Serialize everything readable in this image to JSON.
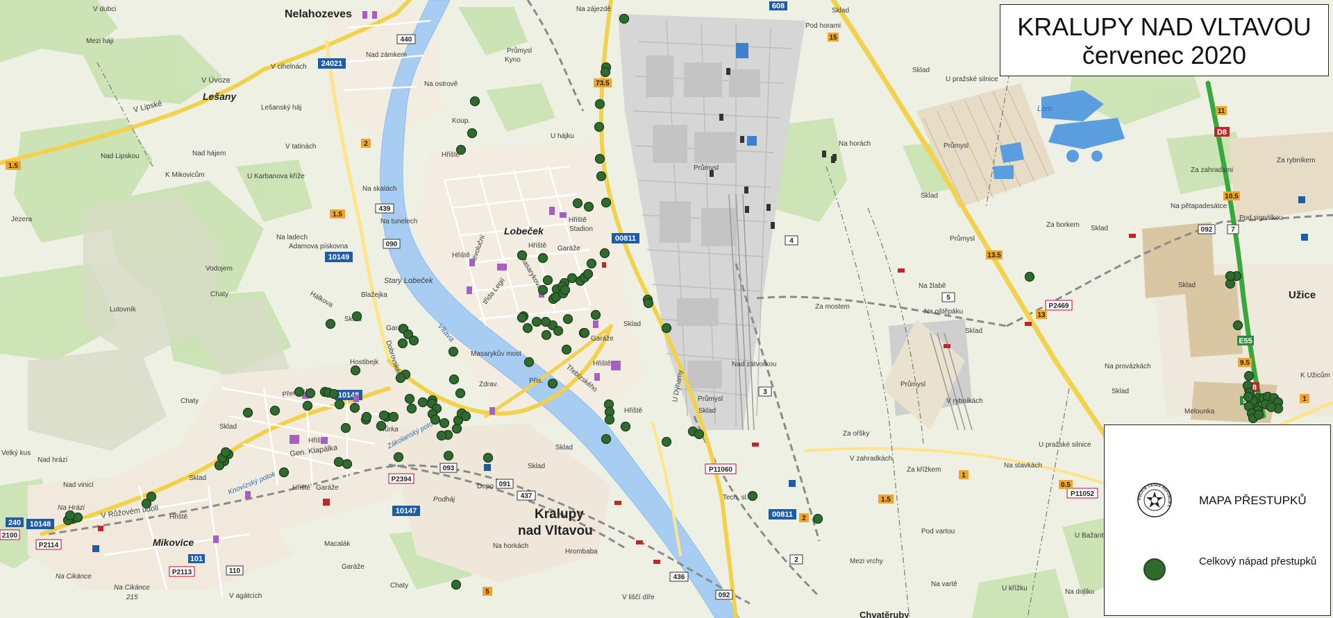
{
  "title": {
    "line1": "KRALUPY NAD VLTAVOU",
    "line2": "červenec 2020"
  },
  "legend": {
    "police_label": "MAPA PŘESTUPKŮ",
    "dot_label": "Celkový nápad přestupků",
    "logo_ring_text": "POLICIE ČESKÉ REPUBLIKY",
    "dot_color": "#2f6a2f"
  },
  "map": {
    "labels": {
      "nelahozeves": "Nelahozeves",
      "kralupy1": "Kralupy",
      "kralupy2": "nad Vltavou",
      "lobecek": "Lobeček",
      "lesany": "Lešany",
      "uzice": "Užice",
      "mikovice": "Mikovice",
      "vltava": "Vltava",
      "stary_lobecek": "Starý Lobeček",
      "prumysl": "Průmysl",
      "za_mostem": "Za mostem",
      "na_horach": "Na horách",
      "lom": "Lom",
      "za_borkem": "Za borkem",
      "na_zlabe": "Na žlabě",
      "na_ostepaku": "Na oštěpáku",
      "v_rybnikach": "V rybníkách",
      "na_provazkach": "Na provázkách",
      "melounka": "Melounka",
      "za_orsky": "Za ořšky",
      "v_zahradkach": "V zahradkách",
      "za_krizkem": "Za křížkem",
      "na_stavkach": "Na stavkách",
      "pod_vartou": "Pod vartou",
      "nad_zatvorkou": "Nad zátvorkou",
      "masarykuv_most": "Masarykův most",
      "prerovska": "Přerovská",
      "v_uvoze": "V Úvoze",
      "v_lipske": "V Lipské",
      "nad_lipskou": "Nad Lipskou",
      "nad_hajem": "Nad hájem",
      "k_mikovicum": "K Mikovicům",
      "v_tatinach": "V tatinách",
      "v_cihelnach": "V cihelnách",
      "mezi_haji": "Mezi háji",
      "v_dubci": "V dubci",
      "nad_zamkem": "Nad zámkem",
      "na_ostrove": "Na ostrově",
      "u_hajku": "U hájku",
      "na_skalach": "Na skalách",
      "na_tunelech": "Na tunelech",
      "na_ladech": "Na ladech",
      "adamova_piskovna": "Adamova pískovna",
      "vodojem": "Vodojem",
      "lutovnik": "Lutovník",
      "chaty": "Chaty",
      "hostibejk": "Hostibejk",
      "blazejka": "Blažejka",
      "halkova": "Hálkova",
      "dobrovskeho": "Dobrovského",
      "garaze": "Garáže",
      "skolni": "Sklad",
      "hriste": "Hřiště",
      "stadion": "Stadion",
      "trebizskeho": "Třebízského",
      "masarykova": "Masarykova",
      "revolucni": "Revoluční",
      "trida_legii": "třída Legií",
      "gen_klapalka": "Gen. Klapálka",
      "v_ruzovem_udoli": "V Růžovém údolí",
      "na_hrazi": "Na Hrázi",
      "na_cikance": "Na Cikánce",
      "na_horkach": "Na horkách",
      "hrombaba": "Hrombaba",
      "podhaji": "Podháj",
      "depo": "Depo",
      "zakolansky_potok": "Zákolanský potok",
      "knovizsky_potok": "Knovízský potok",
      "na_zajezde": "Na zájezdě",
      "pod_horami": "Pod horami",
      "u_prazske_silnice": "U pražské silnice",
      "za_rybnikem": "Za rybníkem",
      "za_zahradami": "Za zahradami",
      "na_petapadesatce": "Na pětapadesátce",
      "pod_signalkou": "Pod signálkou",
      "velky_kus": "Velký kus",
      "nad_hrazi": "Nad hrází",
      "nad_vinici": "Nad vinicí",
      "jezera": "Jezera",
      "kyno": "Kyno",
      "koup": "Koup.",
      "zdrav": "Zdrav.",
      "pris": "Přís.",
      "u_dyhamy": "U Dýhamy",
      "mezi_vrchy": "Mezi vrchy",
      "u_krizku": "U křížku",
      "na_varte": "Na vartě",
      "na_dolku": "Na dolíku",
      "u_bazantnice": "U Bažantnice",
      "k_uzicum": "K Užicům",
      "v_lisci_dire": "V liščí díře",
      "tech_sl": "Tech. sl.",
      "v_agatcich": "V agátcích",
      "macalak": "Macalák",
      "chvatěruby": "Chvatěruby",
      "lesansky_haj": "Lešanský háj",
      "u_karbanova_krize": "U Karbanova kříže",
      "na_cikance_num": "215",
      "mezi": "Sklad",
      "hurka": "Hůrka",
      "rulovci": "Růžové údolí",
      "rybnik": "Sklad",
      "u_prazske2": "U pražské silnice"
    },
    "shields": {
      "r440": "440",
      "r24021": "24021",
      "r439": "439",
      "r10149": "10149",
      "r090": "090",
      "r10148": "10148",
      "r10147": "10147",
      "r093": "093",
      "r091": "091",
      "r437": "437",
      "r436": "436",
      "r092": "092",
      "r00811": "00811",
      "r00811b": "00811",
      "p2394": "P2394",
      "p2114": "P2114",
      "p2113": "P2113",
      "p11060": "P11060",
      "p2469": "P2469",
      "p11052": "P11052",
      "r101": "101",
      "r110": "110",
      "r240": "240",
      "r2100": "2100",
      "r608": "608",
      "r4": "4",
      "r5": "5",
      "r3": "3",
      "r2": "2",
      "r7": "7",
      "d8a": "D8",
      "d8b": "D8",
      "e55": "E55",
      "km73": "73.5",
      "km15": "15",
      "km13": "13",
      "km135": "13.5",
      "km105": "10.5",
      "km95": "9.5",
      "km11": "11",
      "km15b": "1.5",
      "km15c": "1.5",
      "km15d": "1.5",
      "km2": "2",
      "km5": "5",
      "km1": "1",
      "km05": "0.5",
      "km9": "9",
      "km2b": "2",
      "km1b": "1"
    }
  },
  "incidents": [
    [
      899,
      27
    ],
    [
      873,
      97
    ],
    [
      872,
      104
    ],
    [
      684,
      146
    ],
    [
      680,
      192
    ],
    [
      664,
      216
    ],
    [
      864,
      150
    ],
    [
      863,
      183
    ],
    [
      864,
      229
    ],
    [
      866,
      254
    ],
    [
      873,
      292
    ],
    [
      832,
      293
    ],
    [
      848,
      298
    ],
    [
      871,
      365
    ],
    [
      852,
      380
    ],
    [
      824,
      401
    ],
    [
      836,
      405
    ],
    [
      842,
      400
    ],
    [
      847,
      395
    ],
    [
      813,
      408
    ],
    [
      802,
      417
    ],
    [
      810,
      413
    ],
    [
      752,
      368
    ],
    [
      782,
      372
    ],
    [
      789,
      404
    ],
    [
      782,
      418
    ],
    [
      797,
      431
    ],
    [
      801,
      428
    ],
    [
      811,
      423
    ],
    [
      814,
      418
    ],
    [
      754,
      456
    ],
    [
      773,
      464
    ],
    [
      796,
      469
    ],
    [
      786,
      464
    ],
    [
      804,
      477
    ],
    [
      787,
      483
    ],
    [
      818,
      460
    ],
    [
      841,
      480
    ],
    [
      816,
      504
    ],
    [
      752,
      458
    ],
    [
      760,
      473
    ],
    [
      762,
      522
    ],
    [
      796,
      553
    ],
    [
      842,
      480
    ],
    [
      858,
      454
    ],
    [
      933,
      432
    ],
    [
      934,
      437
    ],
    [
      960,
      473
    ],
    [
      877,
      583
    ],
    [
      878,
      594
    ],
    [
      878,
      605
    ],
    [
      873,
      633
    ],
    [
      901,
      615
    ],
    [
      998,
      622
    ],
    [
      1007,
      626
    ],
    [
      960,
      637
    ],
    [
      1084,
      715
    ],
    [
      1178,
      748
    ],
    [
      653,
      507
    ],
    [
      654,
      547
    ],
    [
      663,
      567
    ],
    [
      581,
      474
    ],
    [
      588,
      482
    ],
    [
      596,
      491
    ],
    [
      580,
      495
    ],
    [
      584,
      540
    ],
    [
      577,
      545
    ],
    [
      590,
      575
    ],
    [
      593,
      589
    ],
    [
      609,
      580
    ],
    [
      557,
      601
    ],
    [
      574,
      659
    ],
    [
      623,
      577
    ],
    [
      622,
      582
    ],
    [
      629,
      589
    ],
    [
      623,
      597
    ],
    [
      627,
      605
    ],
    [
      645,
      627
    ],
    [
      660,
      606
    ],
    [
      658,
      618
    ],
    [
      665,
      596
    ],
    [
      671,
      600
    ],
    [
      640,
      610
    ],
    [
      636,
      628
    ],
    [
      646,
      657
    ],
    [
      703,
      660
    ],
    [
      476,
      467
    ],
    [
      514,
      456
    ],
    [
      512,
      534
    ],
    [
      553,
      599
    ],
    [
      567,
      601
    ],
    [
      549,
      614
    ],
    [
      527,
      605
    ],
    [
      498,
      617
    ],
    [
      488,
      666
    ],
    [
      500,
      669
    ],
    [
      409,
      681
    ],
    [
      468,
      565
    ],
    [
      447,
      567
    ],
    [
      396,
      592
    ],
    [
      431,
      565
    ],
    [
      443,
      585
    ],
    [
      357,
      595
    ],
    [
      511,
      588
    ],
    [
      528,
      601
    ],
    [
      473,
      566
    ],
    [
      481,
      568
    ],
    [
      489,
      583
    ],
    [
      329,
      655
    ],
    [
      323,
      665
    ],
    [
      316,
      671
    ],
    [
      320,
      660
    ],
    [
      325,
      652
    ],
    [
      218,
      716
    ],
    [
      211,
      726
    ],
    [
      105,
      748
    ],
    [
      112,
      746
    ],
    [
      98,
      750
    ],
    [
      101,
      743
    ],
    [
      657,
      843
    ],
    [
      1483,
      399
    ],
    [
      1781,
      398
    ],
    [
      1772,
      409
    ],
    [
      1772,
      398
    ],
    [
      1783,
      469
    ],
    [
      1799,
      542
    ],
    [
      1797,
      556
    ],
    [
      1800,
      566
    ],
    [
      1812,
      574
    ],
    [
      1808,
      586
    ],
    [
      1820,
      574
    ],
    [
      1826,
      572
    ],
    [
      1835,
      574
    ],
    [
      1841,
      580
    ],
    [
      1841,
      589
    ],
    [
      1812,
      592
    ],
    [
      1805,
      578
    ],
    [
      1799,
      586
    ],
    [
      1803,
      596
    ],
    [
      1805,
      603
    ],
    [
      1813,
      598
    ],
    [
      1823,
      583
    ],
    [
      1831,
      587
    ],
    [
      1798,
      572
    ]
  ]
}
